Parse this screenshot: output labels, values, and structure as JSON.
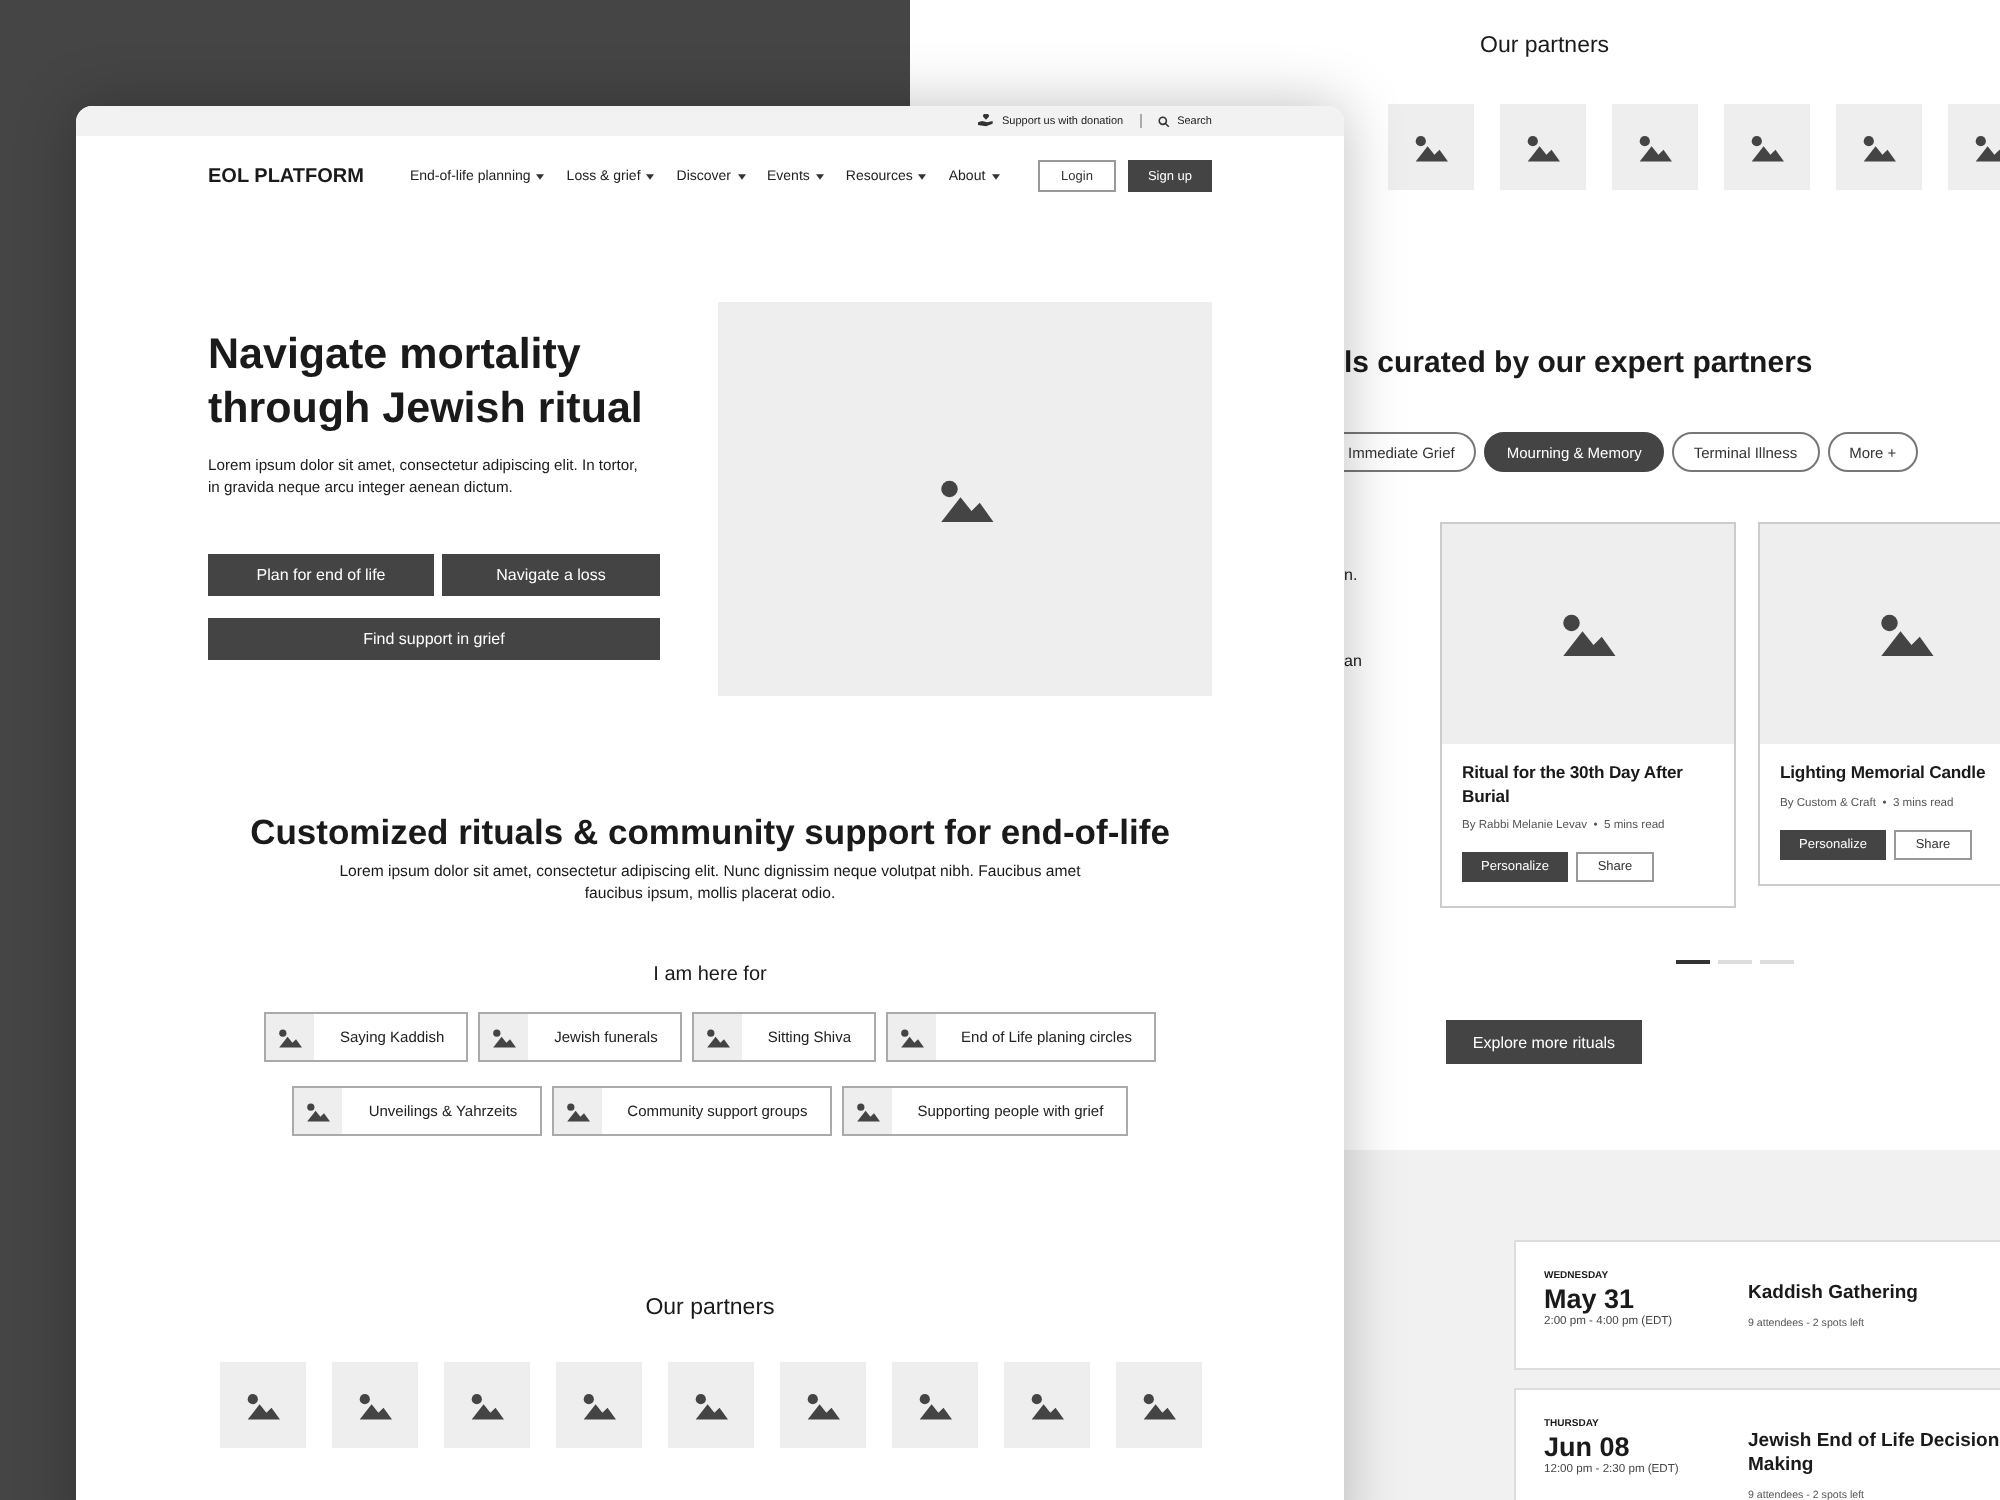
{
  "back_page": {
    "partners_title": "Our partners",
    "partner_logos": [
      {
        "kind": "picture"
      },
      {
        "kind": "picture"
      },
      {
        "kind": "picture"
      },
      {
        "kind": "picture"
      },
      {
        "kind": "picture"
      },
      {
        "kind": "picture"
      }
    ],
    "rituals_title": "ls curated by our expert partners",
    "filters": [
      {
        "label": "Immediate Grief",
        "selected": false
      },
      {
        "label": "Mourning & Memory",
        "selected": true
      },
      {
        "label": "Terminal Illness",
        "selected": false
      },
      {
        "label": "More +",
        "selected": false
      }
    ],
    "text_fragments": [
      "n.",
      "an"
    ],
    "cards": [
      {
        "title": "Ritual for the 30th Day After Burial",
        "meta": "By Rabbi Melanie Levav  •  5 mins read",
        "buttons": [
          "Personalize",
          "Share"
        ]
      },
      {
        "title": "Lighting Memorial Candle",
        "meta": "By Custom & Craft  •  3 mins read",
        "buttons": [
          "Personalize",
          "Share"
        ]
      }
    ],
    "carousel_dots": [
      {
        "selected": true
      },
      {
        "selected": false
      },
      {
        "selected": false
      }
    ],
    "explore_button": "Explore more rituals",
    "events": [
      {
        "weekday": "WEDNESDAY",
        "date": "May 31",
        "time": "2:00 pm - 4:00 pm (EDT)",
        "title": "Kaddish Gathering",
        "meta": "9 attendees - 2 spots left"
      },
      {
        "weekday": "THURSDAY",
        "date": "Jun 08",
        "time": "12:00 pm - 2:30 pm (EDT)",
        "title": "Jewish End of Life Decision Making",
        "meta": "9 attendees - 2 spots left"
      }
    ]
  },
  "front_page": {
    "utility_bar": {
      "donation": "Support us with donation",
      "search": "Search"
    },
    "logo": "EOL PLATFORM",
    "nav": [
      {
        "label": "End-of-life planning"
      },
      {
        "label": "Loss & grief"
      },
      {
        "label": "Discover"
      },
      {
        "label": "Events"
      },
      {
        "label": "Resources"
      },
      {
        "label": "About"
      }
    ],
    "login": "Login",
    "signup": "Sign up",
    "hero": {
      "title": "Navigate mortality through Jewish ritual",
      "text": "Lorem ipsum dolor sit amet, consectetur adipiscing elit. In tortor, in gravida neque arcu integer aenean dictum.",
      "buttons": [
        "Plan for end of life",
        "Navigate a loss",
        "Find support in grief"
      ]
    },
    "section": {
      "title": "Customized rituals & community support for end-of-life",
      "text": "Lorem ipsum dolor sit amet, consectetur adipiscing elit. Nunc dignissim neque volutpat nibh. Faucibus amet faucibus ipsum, mollis placerat odio.",
      "prompt": "I am here for",
      "topics": [
        "Saying Kaddish",
        "Jewish funerals",
        "Sitting Shiva",
        "End of Life planing circles",
        "Unveilings & Yahrzeits",
        "Community support groups",
        "Supporting people with grief"
      ]
    },
    "partners_title": "Our partners",
    "partner_logos": [
      {
        "kind": "picture"
      },
      {
        "kind": "picture"
      },
      {
        "kind": "picture"
      },
      {
        "kind": "picture"
      },
      {
        "kind": "picture"
      },
      {
        "kind": "picture"
      },
      {
        "kind": "picture"
      },
      {
        "kind": "picture"
      },
      {
        "kind": "picture"
      }
    ]
  }
}
